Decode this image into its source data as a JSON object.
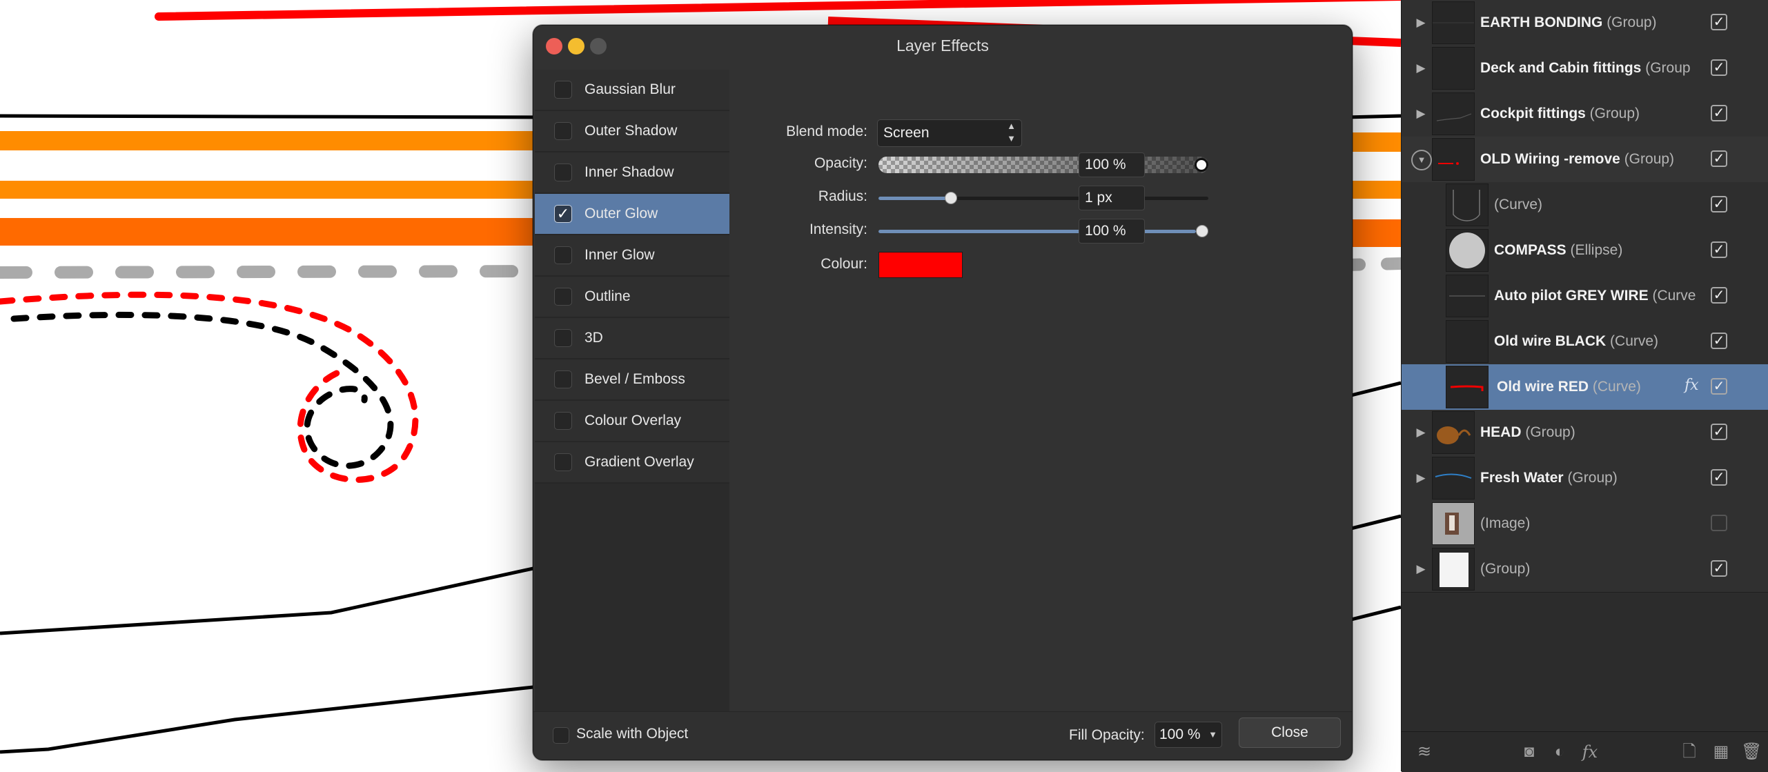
{
  "dialog": {
    "title": "Layer Effects",
    "effects": [
      {
        "label": "Gaussian Blur",
        "checked": false
      },
      {
        "label": "Outer Shadow",
        "checked": false
      },
      {
        "label": "Inner Shadow",
        "checked": false
      },
      {
        "label": "Outer Glow",
        "checked": true
      },
      {
        "label": "Inner Glow",
        "checked": false
      },
      {
        "label": "Outline",
        "checked": false
      },
      {
        "label": "3D",
        "checked": false
      },
      {
        "label": "Bevel / Emboss",
        "checked": false
      },
      {
        "label": "Colour Overlay",
        "checked": false
      },
      {
        "label": "Gradient Overlay",
        "checked": false
      }
    ],
    "selected_effect": "Outer Glow",
    "settings": {
      "blend_mode_label": "Blend mode:",
      "blend_mode_value": "Screen",
      "opacity_label": "Opacity:",
      "opacity_value": "100 %",
      "opacity_level": 1.0,
      "radius_label": "Radius:",
      "radius_value": "1 px",
      "radius_level": 0.22,
      "intensity_label": "Intensity:",
      "intensity_value": "100 %",
      "intensity_level": 1.0,
      "colour_label": "Colour:",
      "colour_value": "#ff0000"
    },
    "footer": {
      "scale_with_object_label": "Scale with Object",
      "fill_opacity_label": "Fill Opacity:",
      "fill_opacity_value": "100 %",
      "close_label": "Close"
    }
  },
  "layers": [
    {
      "name": "EARTH BONDING",
      "type": "(Group)",
      "expandable": true,
      "visible": true
    },
    {
      "name": "Deck and Cabin fittings",
      "type": "(Group",
      "expandable": true,
      "visible": true
    },
    {
      "name": "Cockpit fittings",
      "type": "(Group)",
      "expandable": true,
      "visible": true
    },
    {
      "name": "OLD Wiring -remove",
      "type": "(Group)",
      "expandable": true,
      "expanded": true,
      "visible": true
    },
    {
      "name": "",
      "type": "(Curve)",
      "child": true,
      "visible": true
    },
    {
      "name": "COMPASS",
      "type": "(Ellipse)",
      "child": true,
      "visible": true
    },
    {
      "name": "Auto pilot GREY WIRE",
      "type": "(Curve",
      "child": true,
      "visible": true
    },
    {
      "name": "Old wire BLACK",
      "type": "(Curve)",
      "child": true,
      "visible": true
    },
    {
      "name": "Old wire RED",
      "type": "(Curve)",
      "child": true,
      "selected": true,
      "has_fx": true,
      "visible": true
    },
    {
      "name": "HEAD",
      "type": "(Group)",
      "expandable": true,
      "visible": true
    },
    {
      "name": "Fresh Water",
      "type": "(Group)",
      "expandable": true,
      "visible": true
    },
    {
      "name": "",
      "type": "(Image)",
      "visible": false
    },
    {
      "name": "",
      "type": "(Group)",
      "expandable": true,
      "visible": true
    }
  ],
  "layer_fx_symbol": "fx",
  "layers_toolbar": {
    "icons": [
      "layers-stack-icon",
      "mask-icon",
      "adjustment-icon",
      "fx-icon",
      "new-layer-icon",
      "pixel-layer-icon",
      "trash-icon"
    ]
  },
  "colors": {
    "accent": "#5b7ba6",
    "selected_glow": "#ff0000",
    "traffic_close": "#ed5f57",
    "traffic_min": "#f4bd2f",
    "traffic_zoom": "#555555"
  }
}
